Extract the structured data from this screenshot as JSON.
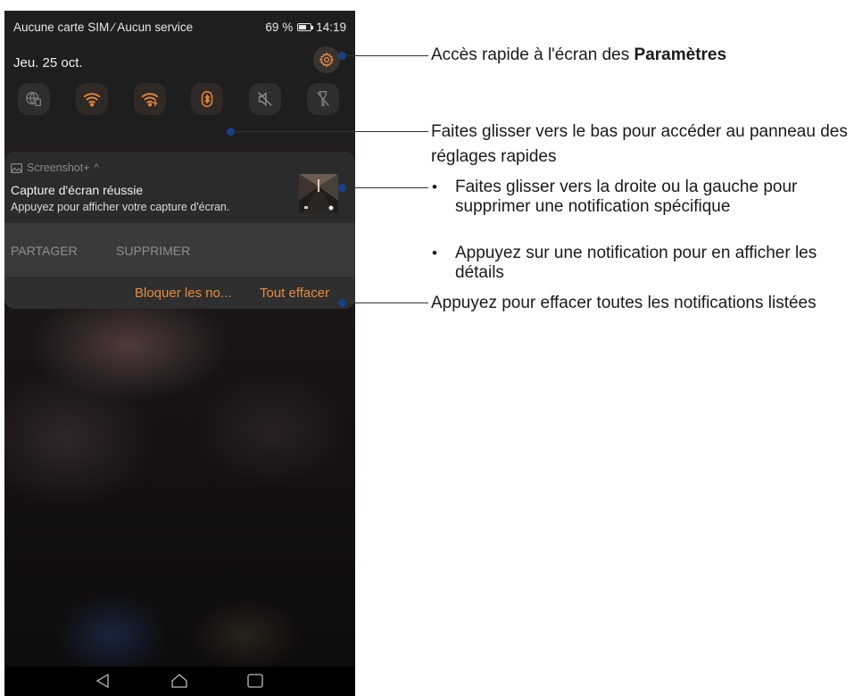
{
  "status_bar": {
    "carrier": "Aucune carte SIM ∕ Aucun service",
    "battery": "69 %",
    "battery_level": 0.69,
    "time": "14:19"
  },
  "date": "Jeu. 25 oct.",
  "quick_tiles": [
    {
      "icon": "globe-sim-icon",
      "active": false
    },
    {
      "icon": "wifi-icon",
      "active": true
    },
    {
      "icon": "wifi-hotspot-icon",
      "active": true
    },
    {
      "icon": "bluetooth-icon",
      "active": true
    },
    {
      "icon": "mute-icon",
      "active": false
    },
    {
      "icon": "flashlight-icon",
      "active": false
    }
  ],
  "notification": {
    "app_name": "Screenshot+",
    "title": "Capture d'écran réussie",
    "text": "Appuyez pour afficher votre capture d'écran.",
    "share_label": "PARTAGER",
    "delete_label": "SUPPRIMER",
    "block_label": "Bloquer les no...",
    "clear_all_label": "Tout effacer"
  },
  "annotations": {
    "settings_prefix": "Accès rapide à l'écran des ",
    "settings_bold": "Paramètres",
    "swipe_down_line1": "Faites glisser vers le bas pour accéder au panneau des",
    "swipe_down_line2": "réglages rapides",
    "bullet": "•",
    "swipe_side_line1": "Faites glisser vers la droite ou la gauche pour",
    "swipe_side_line2": "supprimer une notification spécifique",
    "tap_line1": "Appuyez sur une notification pour en afficher les",
    "tap_line2": "détails",
    "clear_all": "Appuyez pour effacer toutes les notifications listées"
  },
  "colors": {
    "accent_orange": "#e68a3c",
    "marker_blue": "#1c3f8c",
    "panel_dark": "#1e1e1e"
  }
}
